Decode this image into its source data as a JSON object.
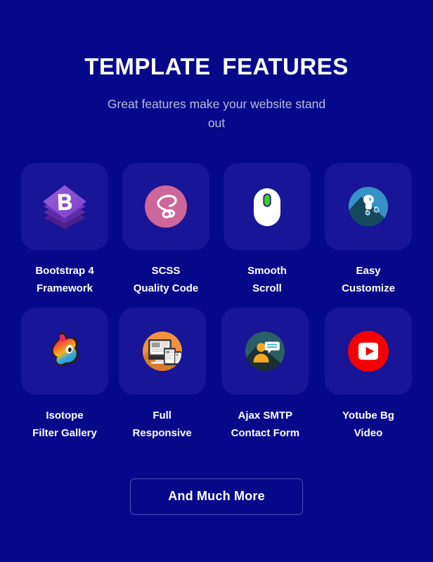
{
  "header": {
    "title": "TEMPLATE  FEATURES",
    "subtitle": "Great features make your website stand out"
  },
  "features": {
    "rows": [
      {
        "items": [
          {
            "icon": "bootstrap-logo-icon",
            "label": "Bootstrap 4\nFramework"
          },
          {
            "icon": "sass-scss-logo-icon",
            "label": "SCSS\nQuality Code"
          },
          {
            "icon": "computer-mouse-icon",
            "label": "Smooth\nScroll"
          },
          {
            "icon": "wrench-gear-icon",
            "label": "Easy\nCustomize"
          }
        ]
      },
      {
        "items": [
          {
            "icon": "isotope-logo-icon",
            "label": "Isotope\nFilter Gallery"
          },
          {
            "icon": "responsive-devices-icon",
            "label": "Full\nResponsive"
          },
          {
            "icon": "contact-person-chat-icon",
            "label": "Ajax SMTP\nContact Form"
          },
          {
            "icon": "youtube-logo-icon",
            "label": "Yotube Bg\nVideo"
          }
        ]
      }
    ]
  },
  "cta": {
    "label": "And Much More"
  },
  "colors": {
    "page_background": "#060a8a",
    "card_background": "#181596",
    "title_text": "#ffffff",
    "subtitle_text": "#b6bcd9",
    "cta_border": "#4b50b6",
    "bootstrap_purple": "#8c52d8",
    "scss_pink": "#cd6799",
    "scroll_green": "#3cd618",
    "customize_blue": "#3691c4",
    "responsive_orange": "#f0923f",
    "contact_teal": "#2a5f66",
    "contact_orange": "#f5a623",
    "youtube_red": "#f50000"
  }
}
